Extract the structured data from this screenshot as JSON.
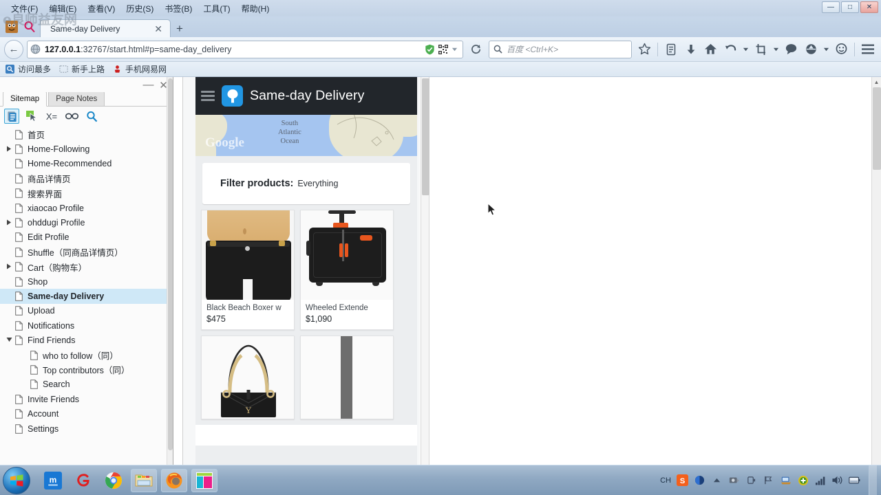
{
  "browser": {
    "menu_items": [
      "文件(F)",
      "编辑(E)",
      "查看(V)",
      "历史(S)",
      "书签(B)",
      "工具(T)",
      "帮助(H)"
    ],
    "window_controls": {
      "minimize": "—",
      "maximize": "□",
      "close": "✕"
    },
    "watermark": "e良师益友网",
    "tab": {
      "title": "Same-day Delivery",
      "close": "✕"
    },
    "new_tab": "+",
    "back_arrow": "←",
    "url": {
      "host": "127.0.0.1",
      "rest": ":32767/start.html#p=same-day_delivery"
    },
    "search": {
      "placeholder": "百度 <Ctrl+K>"
    },
    "bookmarks": [
      "访问最多",
      "新手上路",
      "手机网易网"
    ],
    "toolbar_icons": [
      "bookmark-star-icon",
      "reading-list-icon",
      "download-icon",
      "home-icon",
      "undo-icon",
      "undo-dropdown-icon",
      "screenshot-icon",
      "screenshot-dropdown-icon",
      "chat-icon",
      "account-icon",
      "smiley-icon",
      "menu-icon"
    ],
    "url_icons": [
      "shield-icon",
      "qrcode-icon",
      "qrcode-dropdown-icon",
      "reload-icon"
    ]
  },
  "sitemap": {
    "tabs": [
      {
        "label": "Sitemap",
        "active": true
      },
      {
        "label": "Page Notes",
        "active": false
      }
    ],
    "toolbar": [
      "sitemap-icon",
      "cursor-icon",
      "variables-icon",
      "link-icon",
      "search-icon"
    ],
    "minimize": "—",
    "close": "✕",
    "nodes": [
      {
        "label": "首页",
        "depth": 0,
        "arrow": "",
        "selected": false
      },
      {
        "label": "Home-Following",
        "depth": 0,
        "arrow": "right",
        "selected": false
      },
      {
        "label": "Home-Recommended",
        "depth": 0,
        "arrow": "",
        "selected": false
      },
      {
        "label": "商品详情页",
        "depth": 0,
        "arrow": "",
        "selected": false
      },
      {
        "label": "搜索界面",
        "depth": 0,
        "arrow": "",
        "selected": false
      },
      {
        "label": "xiaocao Profile",
        "depth": 0,
        "arrow": "",
        "selected": false
      },
      {
        "label": "ohddugi Profile",
        "depth": 0,
        "arrow": "right",
        "selected": false
      },
      {
        "label": "Edit Profile",
        "depth": 0,
        "arrow": "",
        "selected": false
      },
      {
        "label": "Shuffle（同商品详情页）",
        "depth": 0,
        "arrow": "",
        "selected": false
      },
      {
        "label": "Cart（购物车）",
        "depth": 0,
        "arrow": "right",
        "selected": false
      },
      {
        "label": "Shop",
        "depth": 0,
        "arrow": "",
        "selected": false
      },
      {
        "label": "Same-day Delivery",
        "depth": 0,
        "arrow": "",
        "selected": true
      },
      {
        "label": "Upload",
        "depth": 0,
        "arrow": "",
        "selected": false
      },
      {
        "label": "Notifications",
        "depth": 0,
        "arrow": "",
        "selected": false
      },
      {
        "label": "Find Friends",
        "depth": 0,
        "arrow": "down",
        "selected": false
      },
      {
        "label": "who to follow（同）",
        "depth": 1,
        "arrow": "",
        "selected": false
      },
      {
        "label": "Top contributors（同）",
        "depth": 1,
        "arrow": "",
        "selected": false
      },
      {
        "label": "Search",
        "depth": 1,
        "arrow": "",
        "selected": false
      },
      {
        "label": "Invite Friends",
        "depth": 0,
        "arrow": "",
        "selected": false
      },
      {
        "label": "Account",
        "depth": 0,
        "arrow": "",
        "selected": false
      },
      {
        "label": "Settings",
        "depth": 0,
        "arrow": "",
        "selected": false
      }
    ]
  },
  "app": {
    "header": {
      "title": "Same-day Delivery",
      "menu_icon": "hamburger-icon",
      "logo_icon": "app-logo-icon"
    },
    "map": {
      "ocean_label": "South\nAtlantic\nOcean",
      "ocean_line1": "South",
      "ocean_line2": "Atlantic",
      "ocean_line3": "Ocean",
      "attribution": "Google"
    },
    "filter": {
      "label": "Filter products:",
      "value": "Everything"
    },
    "products": [
      {
        "name": "Black Beach Boxer w",
        "price": "$475",
        "image": "black-shorts-photo",
        "has_meta": true
      },
      {
        "name": "Wheeled Extende",
        "price": "$1,090",
        "image": "black-suitcase-photo",
        "has_meta": true
      },
      {
        "name": "",
        "price": "",
        "image": "black-quilted-handbag-photo",
        "has_meta": false
      },
      {
        "name": "",
        "price": "",
        "image": "grey-strap-photo",
        "has_meta": false
      }
    ]
  },
  "taskbar": {
    "start": "start-orb-icon",
    "apps": [
      {
        "name": "maxthon-icon",
        "open": false
      },
      {
        "name": "gif-tool-icon",
        "open": false
      },
      {
        "name": "chrome-icon",
        "open": false
      },
      {
        "name": "file-explorer-icon",
        "open": true
      },
      {
        "name": "firefox-icon",
        "open": true
      },
      {
        "name": "axure-rp-icon",
        "open": true
      }
    ],
    "tray": {
      "language": "CH",
      "icons": [
        "sogou-ime-icon",
        "sogou-pinyin-icon",
        "show-hidden-icon",
        "safe-icon",
        "usb-icon",
        "flag-icon",
        "network-monitor-icon",
        "update-icon",
        "signal-icon",
        "volume-icon",
        "battery-icon"
      ]
    }
  }
}
